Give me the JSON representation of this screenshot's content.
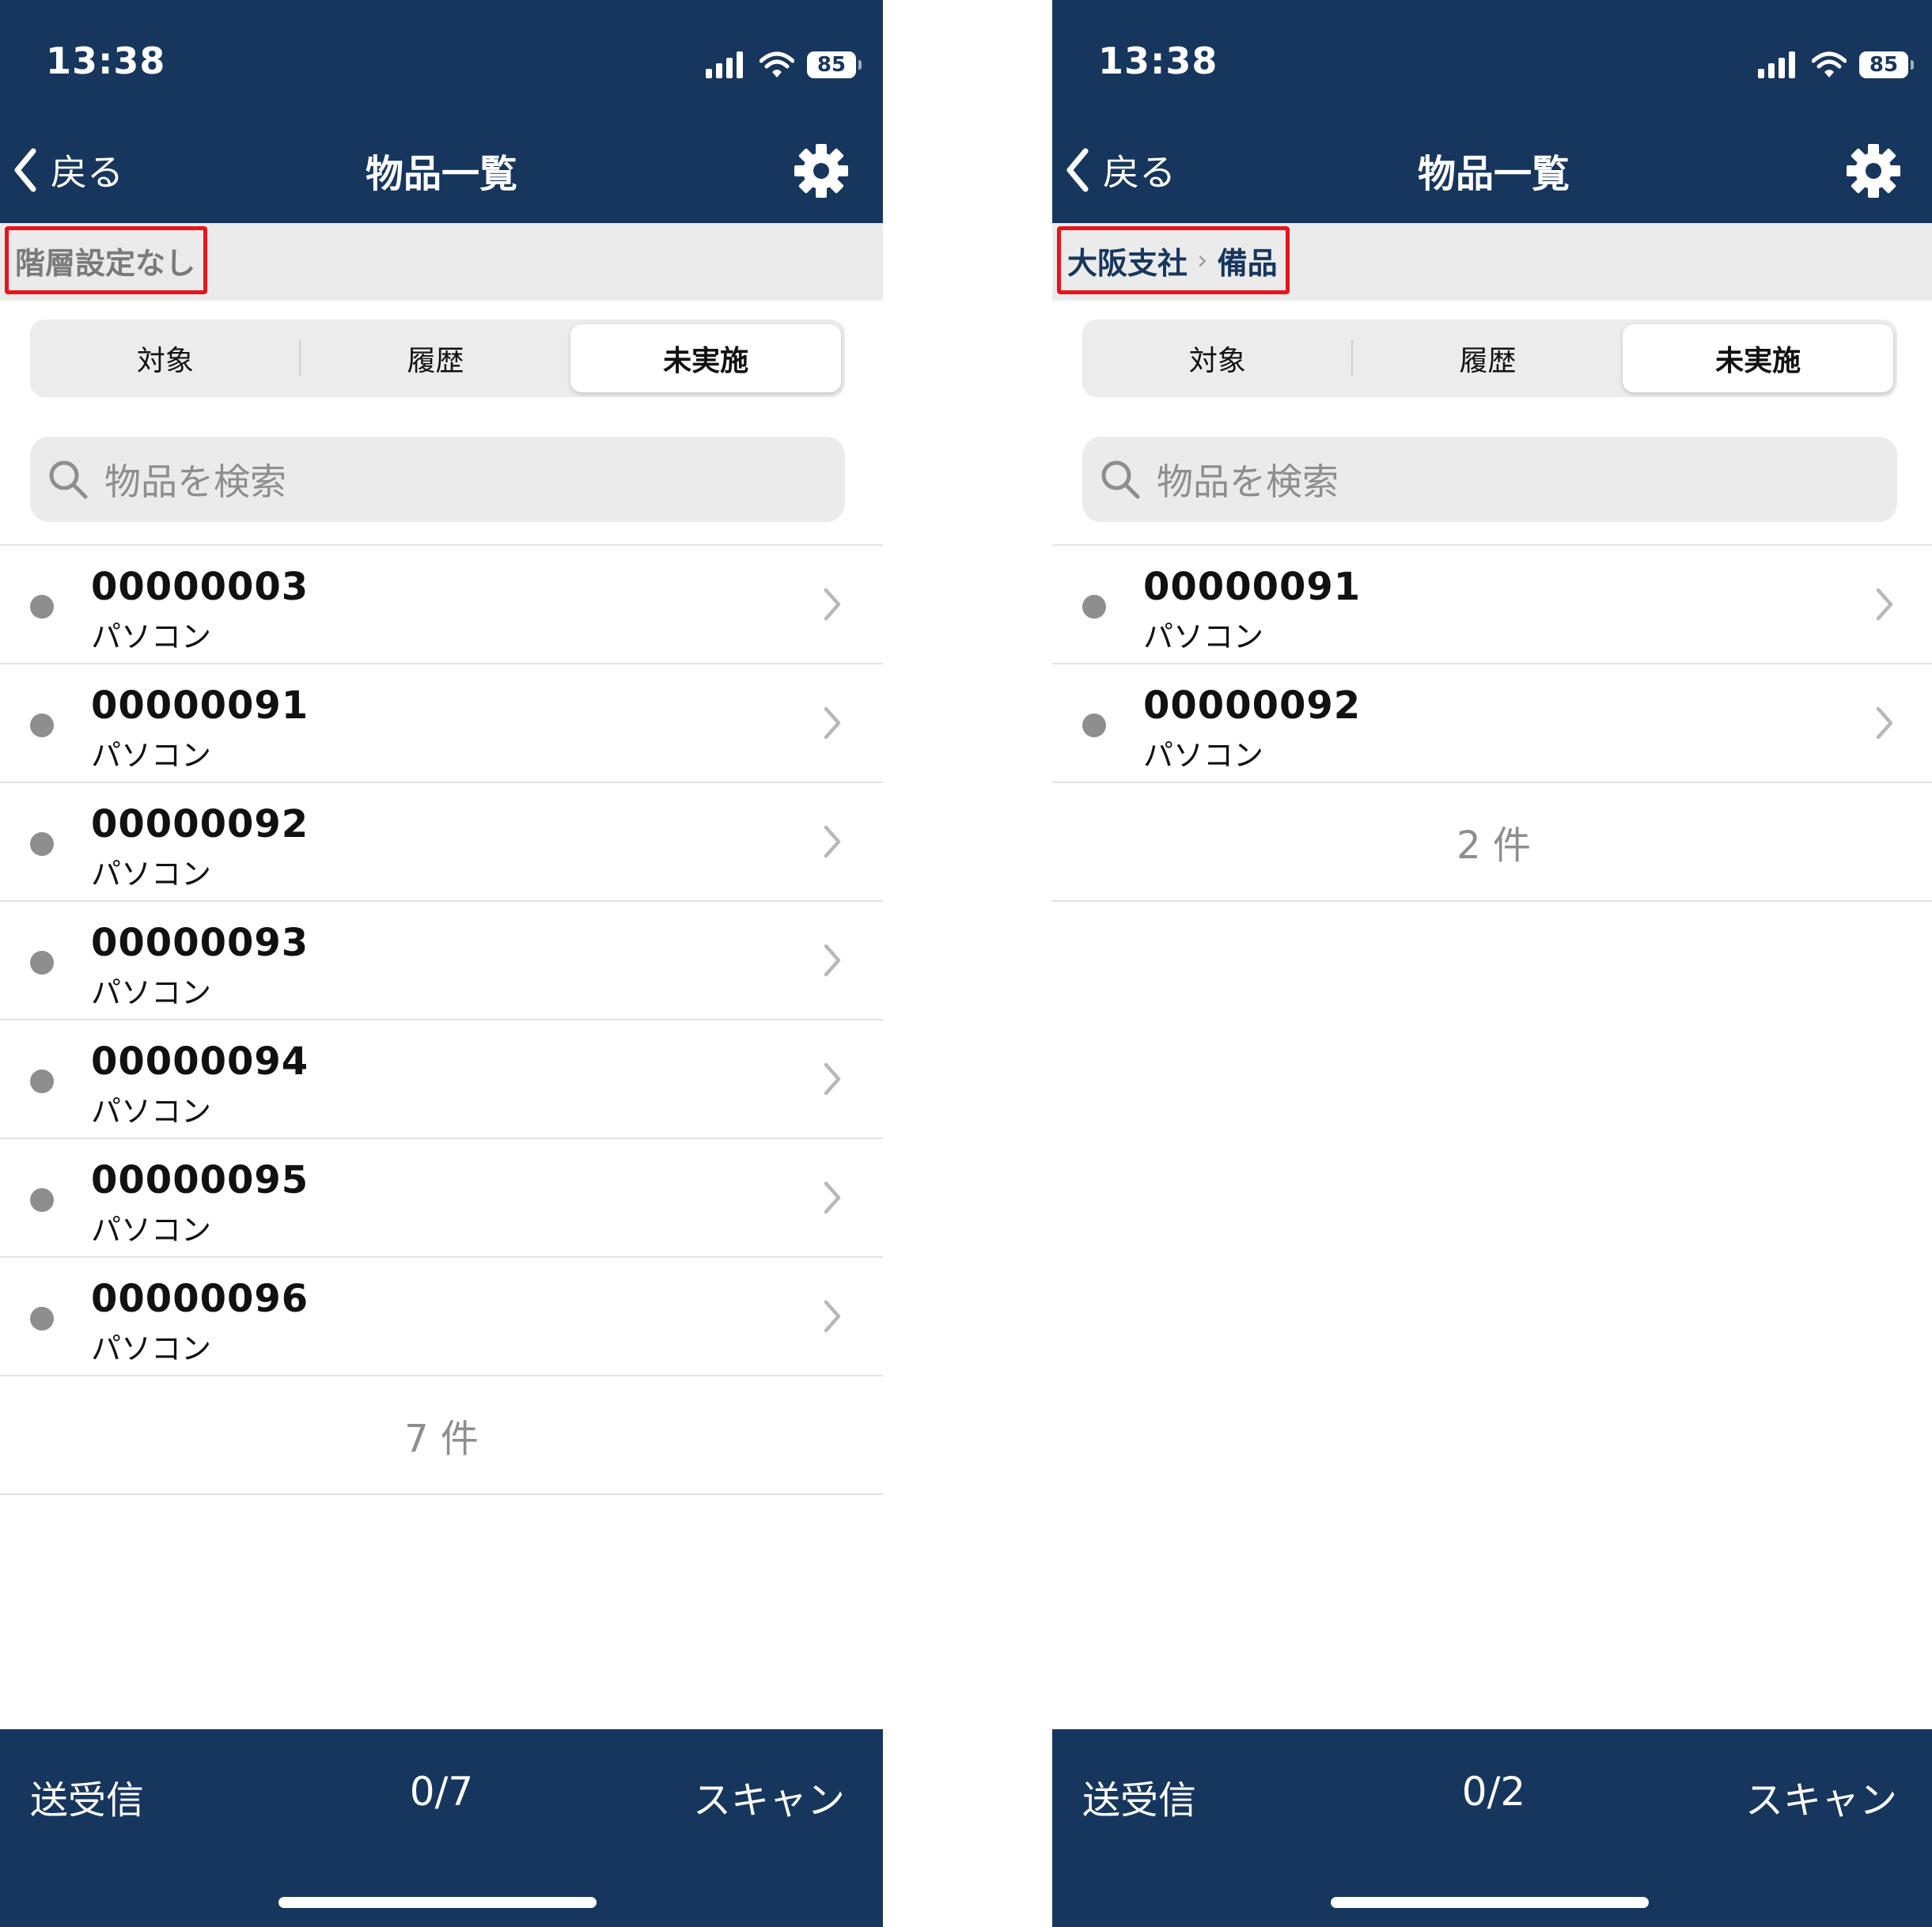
{
  "screens": [
    {
      "status_time": "13:38",
      "battery": "85",
      "back_label": "戻る",
      "title": "物品一覧",
      "breadcrumb": {
        "first": "階層設定なし",
        "second": ""
      },
      "tabs": [
        "対象",
        "履歴",
        "未実施"
      ],
      "search_placeholder": "物品を検索",
      "items": [
        {
          "code": "00000003",
          "name": "パソコン"
        },
        {
          "code": "00000091",
          "name": "パソコン"
        },
        {
          "code": "00000092",
          "name": "パソコン"
        },
        {
          "code": "00000093",
          "name": "パソコン"
        },
        {
          "code": "00000094",
          "name": "パソコン"
        },
        {
          "code": "00000095",
          "name": "パソコン"
        },
        {
          "code": "00000096",
          "name": "パソコン"
        }
      ],
      "count": "7 件",
      "bottom": {
        "left": "送受信",
        "center": "0/7",
        "right": "スキャン"
      }
    },
    {
      "status_time": "13:38",
      "battery": "85",
      "back_label": "戻る",
      "title": "物品一覧",
      "breadcrumb": {
        "first": "大阪支社",
        "second": "備品"
      },
      "tabs": [
        "対象",
        "履歴",
        "未実施"
      ],
      "search_placeholder": "物品を検索",
      "items": [
        {
          "code": "00000091",
          "name": "パソコン"
        },
        {
          "code": "00000092",
          "name": "パソコン"
        }
      ],
      "count": "2 件",
      "bottom": {
        "left": "送受信",
        "center": "0/2",
        "right": "スキャン"
      }
    }
  ],
  "colors": {
    "navy": "#17365e",
    "highlight_red": "#e8141b",
    "breadcrumb_bg": "#ebebeb",
    "dot_gray": "#8e8e8e"
  },
  "icons": [
    "signal-icon",
    "wifi-icon",
    "battery-icon",
    "back-chevron-icon",
    "gear-icon",
    "search-icon",
    "status-dot-icon",
    "chevron-right-icon"
  ]
}
